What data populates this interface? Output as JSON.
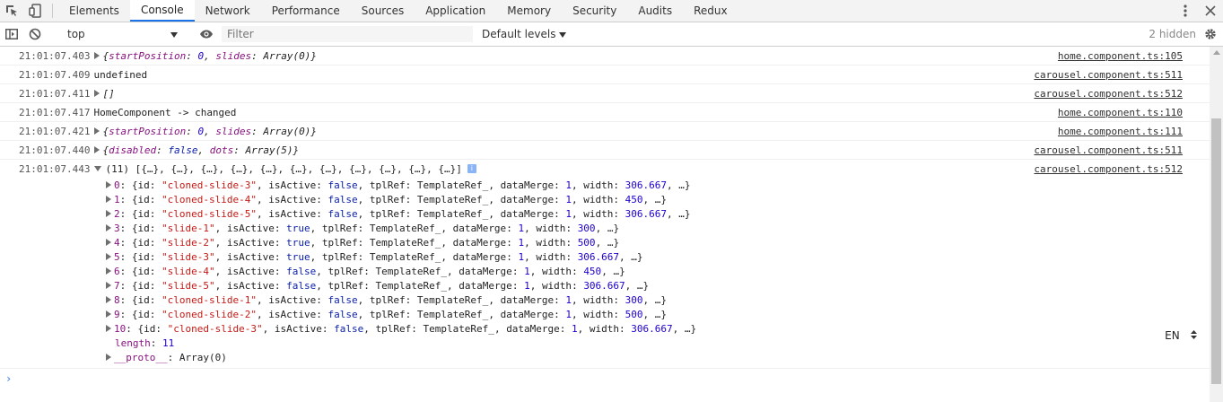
{
  "tabs": [
    "Elements",
    "Console",
    "Network",
    "Performance",
    "Sources",
    "Application",
    "Memory",
    "Security",
    "Audits",
    "Redux"
  ],
  "active_tab": "Console",
  "toolbar": {
    "context": "top",
    "filter_placeholder": "Filter",
    "levels": "Default levels",
    "hidden": "2 hidden"
  },
  "messages": [
    {
      "ts": "21:01:07.403",
      "src": "home.component.ts:105"
    },
    {
      "ts": "21:01:07.409",
      "text": "undefined",
      "src": "carousel.component.ts:511"
    },
    {
      "ts": "21:01:07.411",
      "text": "[]",
      "src": "carousel.component.ts:512"
    },
    {
      "ts": "21:01:07.417",
      "text": "HomeComponent -> changed",
      "src": "home.component.ts:110"
    },
    {
      "ts": "21:01:07.421",
      "src": "home.component.ts:111"
    },
    {
      "ts": "21:01:07.440",
      "src": "carousel.component.ts:511"
    },
    {
      "ts": "21:01:07.443",
      "summary": "(11) [{…}, {…}, {…}, {…}, {…}, {…}, {…}, {…}, {…}, {…}, {…}]",
      "src": "carousel.component.ts:512"
    }
  ],
  "obj1": {
    "k1": "startPosition",
    "v1": "0",
    "k2": "slides",
    "v2": "Array(0)"
  },
  "obj2": {
    "k1": "disabled",
    "v1": "false",
    "k2": "dots",
    "v2": "Array(5)"
  },
  "slides": [
    {
      "idx": "0",
      "id": "\"cloned-slide-3\"",
      "active": "false",
      "merge": "1",
      "width": "306.667"
    },
    {
      "idx": "1",
      "id": "\"cloned-slide-4\"",
      "active": "false",
      "merge": "1",
      "width": "450"
    },
    {
      "idx": "2",
      "id": "\"cloned-slide-5\"",
      "active": "false",
      "merge": "1",
      "width": "306.667"
    },
    {
      "idx": "3",
      "id": "\"slide-1\"",
      "active": "true",
      "merge": "1",
      "width": "300"
    },
    {
      "idx": "4",
      "id": "\"slide-2\"",
      "active": "true",
      "merge": "1",
      "width": "500"
    },
    {
      "idx": "5",
      "id": "\"slide-3\"",
      "active": "true",
      "merge": "1",
      "width": "306.667"
    },
    {
      "idx": "6",
      "id": "\"slide-4\"",
      "active": "false",
      "merge": "1",
      "width": "450"
    },
    {
      "idx": "7",
      "id": "\"slide-5\"",
      "active": "false",
      "merge": "1",
      "width": "306.667"
    },
    {
      "idx": "8",
      "id": "\"cloned-slide-1\"",
      "active": "false",
      "merge": "1",
      "width": "300"
    },
    {
      "idx": "9",
      "id": "\"cloned-slide-2\"",
      "active": "false",
      "merge": "1",
      "width": "500"
    },
    {
      "idx": "10",
      "id": "\"cloned-slide-3\"",
      "active": "false",
      "merge": "1",
      "width": "306.667"
    }
  ],
  "labels": {
    "id": "id",
    "is_active": "isActive",
    "tpl_ref": "tplRef",
    "tpl_val": "TemplateRef_",
    "data_merge": "dataMerge",
    "width": "width",
    "ellipsis": "…"
  },
  "length": {
    "key": "length",
    "value": "11"
  },
  "proto": {
    "key": "__proto__",
    "value": "Array(0)"
  },
  "prompt": "›",
  "lang": "EN"
}
